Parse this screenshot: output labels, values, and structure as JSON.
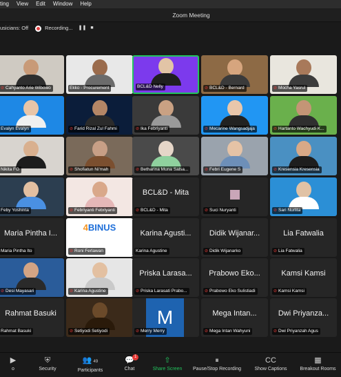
{
  "menubar": {
    "items": [
      "ting",
      "View",
      "Edit",
      "Window",
      "Help"
    ]
  },
  "window": {
    "title": "Zoom Meeting"
  },
  "status": {
    "musicians": "usicians: Off",
    "recording": "Recording...",
    "pause_icon": "pause-icon",
    "stop_icon": "stop-icon"
  },
  "participants": [
    {
      "name": "Cahyanto Arie Wibowo",
      "muted": true,
      "video": true,
      "bg": "#cfcac2",
      "skin": "#c89a78",
      "shirt": "#2e2e2e"
    },
    {
      "name": "Ekko - Procurement",
      "muted": false,
      "video": true,
      "bg": "#e8e8e8",
      "skin": "#9a6b4c",
      "shirt": "#6b6b6b"
    },
    {
      "name": "BCL&D Nelly",
      "muted": false,
      "video": true,
      "active": true,
      "bg": "#7c3aed",
      "skin": "#e2c4a6",
      "shirt": "#1f1f1f"
    },
    {
      "name": "BCL&D - Bernard",
      "muted": true,
      "video": true,
      "bg": "#8d6a45",
      "skin": "#d6a57e",
      "shirt": "#3a3a3a"
    },
    {
      "name": "Mocha Yasrul",
      "muted": true,
      "video": true,
      "bg": "#e9e6de",
      "skin": "#a8795a",
      "shirt": "#3c3c3c"
    },
    {
      "name": "Evalyn Evalyn",
      "muted": false,
      "video": true,
      "bg": "#1e88e5",
      "skin": "#e8c5a8",
      "shirt": "#f0f0f0"
    },
    {
      "name": "Farid Rizal Zul Fahmi",
      "muted": true,
      "video": true,
      "bg": "#0b1d3a",
      "skin": "#b48666",
      "shirt": "#2b2b2b"
    },
    {
      "name": "Ika Febriyanti",
      "muted": true,
      "video": true,
      "bg": "#3a3a3a",
      "skin": "#c9a183",
      "shirt": "#9a9a9a"
    },
    {
      "name": "Mecarine Wangsadjaja",
      "muted": true,
      "video": true,
      "bg": "#2196f3",
      "skin": "#e9c7ab",
      "shirt": "#222222"
    },
    {
      "name": "Hartanto Wachyudi K...",
      "muted": true,
      "video": true,
      "bg": "#6ab04c",
      "skin": "#c49576",
      "shirt": "#2f2f2f"
    },
    {
      "name": "Nikita FG",
      "muted": false,
      "video": true,
      "bg": "#d8d4cf",
      "skin": "#d9b08f",
      "shirt": "#1c1c1c"
    },
    {
      "name": "Shofiatun Ni'mah",
      "muted": true,
      "video": true,
      "bg": "#7a6a5a",
      "skin": "#c79f86",
      "shirt": "#7b4f2f"
    },
    {
      "name": "Betharina Muna Salsa...",
      "muted": true,
      "video": true,
      "bg": "#4a4a4a",
      "skin": "#e6d6c8",
      "shirt": "#8fd19e"
    },
    {
      "name": "Febri Eugene S",
      "muted": true,
      "video": true,
      "bg": "#9aa3ad",
      "skin": "#e5c3a6",
      "shirt": "#6d8fb8"
    },
    {
      "name": "Kresensia Kresensia",
      "muted": true,
      "video": true,
      "bg": "#4a90c2",
      "skin": "#d8a987",
      "shirt": "#1e1e1e"
    },
    {
      "name": "Feby Yoshinta",
      "muted": false,
      "video": true,
      "bg": "#2c3e50",
      "skin": "#e2bfa1",
      "shirt": "#4a90e2"
    },
    {
      "name": "Febriyanti Febriyanti",
      "muted": true,
      "video": true,
      "bg": "#f3e7e3",
      "skin": "#d9a88a",
      "shirt": "#e5b7b7"
    },
    {
      "name": "BCL&D - Mita",
      "muted": true,
      "video": false,
      "big": "BCL&D - Mita"
    },
    {
      "name": "Suci Nuryanti",
      "muted": true,
      "video": false,
      "thumb": "#c9a6b8"
    },
    {
      "name": "Sari Nurlita",
      "muted": true,
      "video": true,
      "bg": "#2b8fd6",
      "skin": "#e0c2a5",
      "shirt": "#ffffff"
    },
    {
      "name": "Maria Pintha Ito",
      "muted": false,
      "video": false,
      "big": "Maria Pintha I..."
    },
    {
      "name": "Roni Ferlawan",
      "muted": true,
      "video": true,
      "logo": "BINUS"
    },
    {
      "name": "Karina Agustine",
      "muted": false,
      "video": false,
      "big": "Karina Agusti..."
    },
    {
      "name": "Didik Wijanarko",
      "muted": true,
      "video": false,
      "big": "Didik Wijanar..."
    },
    {
      "name": "Lia Fatwalia",
      "muted": true,
      "video": false,
      "big": "Lia Fatwalia"
    },
    {
      "name": "Desi Mayasari",
      "muted": true,
      "video": true,
      "bg": "#2a5c9a",
      "skin": "#d3a484",
      "shirt": "#2a2a2a"
    },
    {
      "name": "Karina Agustine",
      "muted": true,
      "video": true,
      "bg": "#e6e6e6",
      "skin": "#e3c0a1",
      "shirt": "#c9c9c9"
    },
    {
      "name": "Priska Larasati Prabo...",
      "muted": true,
      "video": false,
      "big": "Priska Larasa..."
    },
    {
      "name": "Prabowo Eko Sulistiadi",
      "muted": true,
      "video": false,
      "big": "Prabowo Eko..."
    },
    {
      "name": "Kamsi Kamsi",
      "muted": true,
      "video": false,
      "big": "Kamsi Kamsi"
    },
    {
      "name": "Rahmat Basuki",
      "muted": false,
      "video": false,
      "big": "Rahmat Basuki"
    },
    {
      "name": "Setiyodi Setiyodi",
      "muted": true,
      "video": true,
      "bg": "#3b2a1a",
      "skin": "#6b4a2a",
      "shirt": "#2a1a0a"
    },
    {
      "name": "Merry Merry",
      "muted": true,
      "video": false,
      "avatar": "M"
    },
    {
      "name": "Mega Intan Wahyuni",
      "muted": true,
      "video": false,
      "big": "Mega Intan..."
    },
    {
      "name": "Dwi Priyanzah Agus",
      "muted": true,
      "video": false,
      "big": "Dwi Priyanza..."
    }
  ],
  "toolbar": {
    "items": [
      {
        "label": "o",
        "icon": "video-icon"
      },
      {
        "label": "Security",
        "icon": "shield-icon"
      },
      {
        "label": "Participants",
        "icon": "participants-icon",
        "count": "49"
      },
      {
        "label": "Chat",
        "icon": "chat-icon",
        "badge": "1"
      },
      {
        "label": "Share Screen",
        "icon": "share-screen-icon"
      },
      {
        "label": "Pause/Stop Recording",
        "icon": "recording-icon"
      },
      {
        "label": "Show Captions",
        "icon": "captions-icon"
      },
      {
        "label": "Breakout Rooms",
        "icon": "breakout-rooms-icon"
      }
    ]
  },
  "colors": {
    "active_border": "#22c55e",
    "mute": "#e53935",
    "share": "#22c55e"
  }
}
